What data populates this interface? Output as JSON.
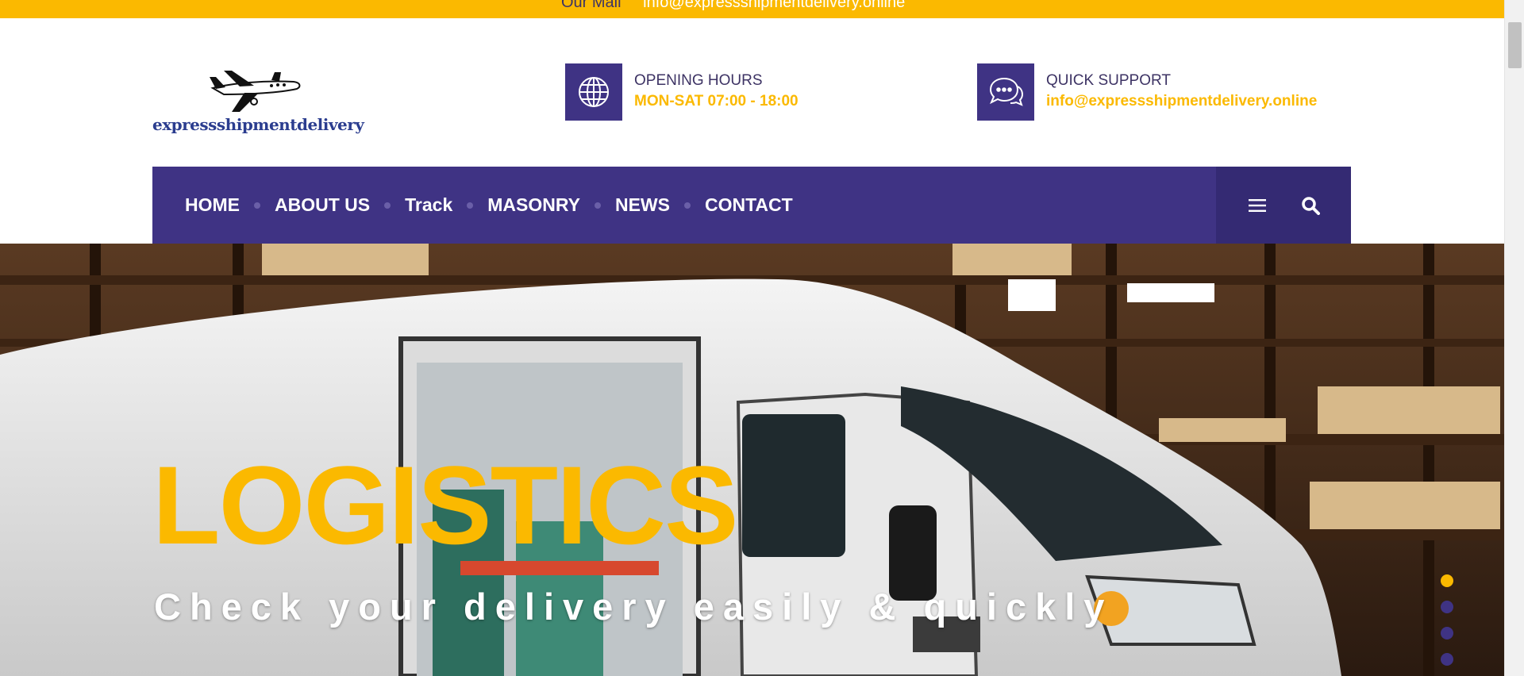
{
  "topbar": {
    "label": "Our Mail",
    "email": "info@expressshipmentdelivery.online"
  },
  "logo": {
    "text": "expressshipmentdelivery"
  },
  "opening_hours": {
    "label": "OPENING HOURS",
    "value": "MON-SAT 07:00 - 18:00",
    "icon": "globe-icon"
  },
  "support": {
    "label": "QUICK SUPPORT",
    "value": "info@expressshipmentdelivery.online",
    "icon": "chat-bubbles-icon"
  },
  "nav": {
    "items": [
      {
        "label": "HOME"
      },
      {
        "label": "ABOUT US"
      },
      {
        "label": "Track"
      },
      {
        "label": "MASONRY"
      },
      {
        "label": "NEWS"
      },
      {
        "label": "CONTACT"
      }
    ],
    "menu_icon": "hamburger-menu-icon",
    "search_icon": "search-icon"
  },
  "hero": {
    "title": "LOGISTICS",
    "subtitle": "Check your delivery easily & quickly",
    "slides": [
      {
        "active": true
      },
      {
        "active": false
      },
      {
        "active": false
      },
      {
        "active": false
      }
    ]
  },
  "colors": {
    "accent": "#fbb900",
    "brand": "#3f3384",
    "brand_dark": "#342a73"
  }
}
